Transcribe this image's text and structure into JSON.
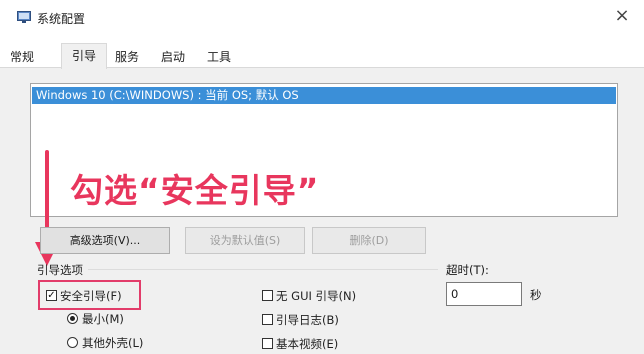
{
  "window": {
    "title": "系统配置",
    "icon": "msconfig-icon",
    "close_glyph": "×"
  },
  "tabs": [
    {
      "label": "常规",
      "active": false
    },
    {
      "label": "引导",
      "active": true
    },
    {
      "label": "服务",
      "active": false
    },
    {
      "label": "启动",
      "active": false
    },
    {
      "label": "工具",
      "active": false
    }
  ],
  "boot_list": {
    "entries": [
      "Windows 10 (C:\\WINDOWS) : 当前 OS; 默认 OS"
    ],
    "selected_index": 0
  },
  "annotation": {
    "text": "勾选“安全引导”",
    "color": "#e8365d"
  },
  "buttons": {
    "advanced": "高级选项(V)...",
    "set_default": "设为默认值(S)",
    "delete": "删除(D)"
  },
  "boot_options": {
    "group_label": "引导选项",
    "safe_boot": {
      "label": "安全引导(F)",
      "checked": true
    },
    "minimal": {
      "label": "最小(M)",
      "selected": true
    },
    "alternate_shell": {
      "label": "其他外壳(L)",
      "selected": false
    },
    "no_gui": {
      "label": "无 GUI 引导(N)",
      "checked": false
    },
    "boot_log": {
      "label": "引导日志(B)",
      "checked": false
    },
    "base_video": {
      "label": "基本视频(E)",
      "checked": false
    }
  },
  "timeout": {
    "label": "超时(T):",
    "value": "0",
    "unit": "秒"
  }
}
